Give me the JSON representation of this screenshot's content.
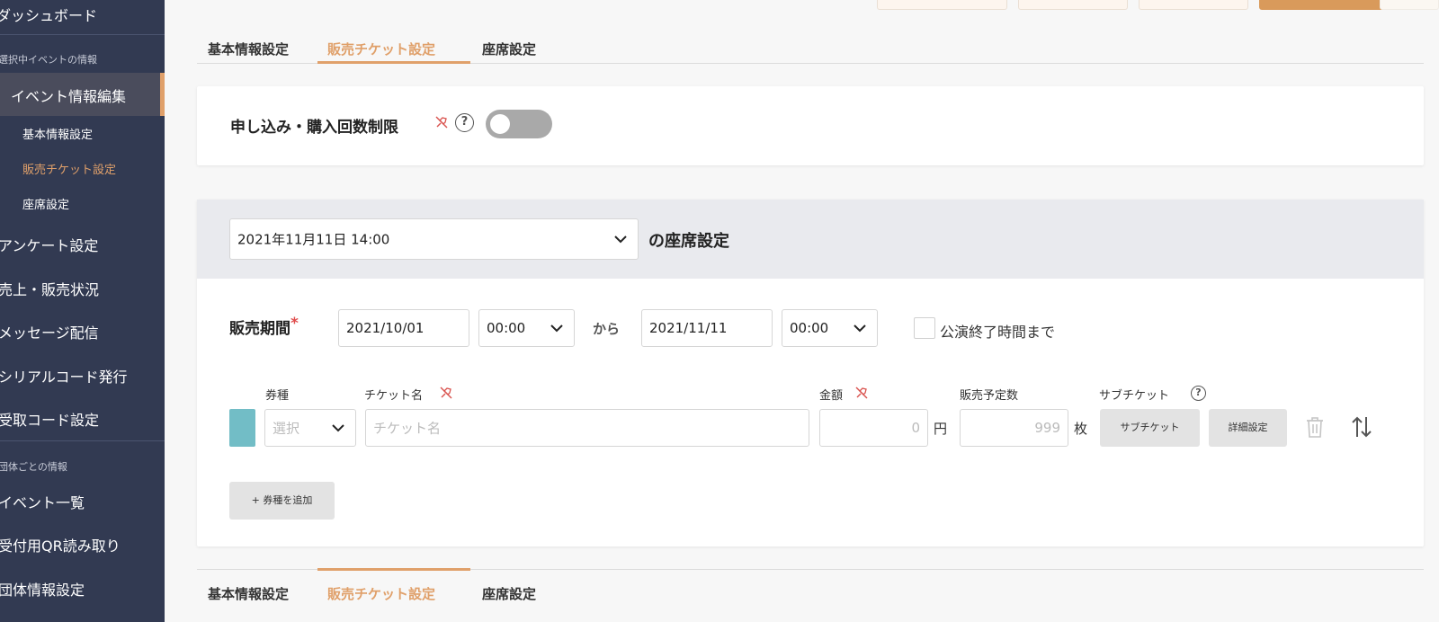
{
  "sidebar": {
    "dashboard": "ダッシュボード",
    "section_event": "選択中イベントの情報",
    "event_edit": "イベント情報編集",
    "sub_basic": "基本情報設定",
    "sub_ticket": "販売チケット設定",
    "sub_seat": "座席設定",
    "survey": "アンケート設定",
    "sales": "売上・販売状況",
    "message": "メッセージ配信",
    "serial": "シリアルコード発行",
    "receipt": "受取コード設定",
    "section_group": "団体ごとの情報",
    "event_list": "イベント一覧",
    "qr": "受付用QR読み取り",
    "group_settings": "団体情報設定"
  },
  "tabs": [
    "基本情報設定",
    "販売チケット設定",
    "座席設定"
  ],
  "limit_card": {
    "label": "申し込み・購入回数制限",
    "help": "?",
    "toggle_on": false
  },
  "seat": {
    "date_select": "2021年11月11日 14:00",
    "suffix": "の座席設定"
  },
  "period": {
    "label": "販売期間",
    "required_mark": "*",
    "start_date": "2021/10/01",
    "start_time": "00:00",
    "from": "から",
    "end_date": "2021/11/11",
    "end_time": "00:00",
    "until_end_label": "公演終了時間まで"
  },
  "ticket": {
    "col_type": "券種",
    "col_name": "チケット名",
    "col_price": "金額",
    "col_quantity": "販売予定数",
    "col_sub": "サブチケット",
    "type_placeholder": "選択",
    "name_placeholder": "チケット名",
    "price_placeholder": "0",
    "yen": "円",
    "qty_placeholder": "999",
    "mai": "枚",
    "sub_button": "サブチケット",
    "detail_button": "詳細設定",
    "add_button": "+ 券種を追加"
  },
  "colors": {
    "accent": "#e0a06a",
    "sidebar": "#323a52",
    "swatch": "#72bdc6"
  }
}
